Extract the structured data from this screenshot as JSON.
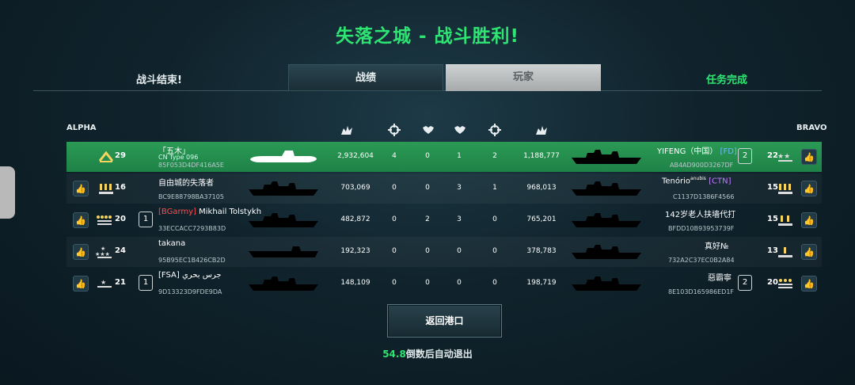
{
  "title": "失落之城 - 战斗胜利!",
  "header": {
    "battle_over": "战斗结束!",
    "tabs": [
      "战绩",
      "玩家"
    ],
    "mission_status": "任务完成"
  },
  "teams": {
    "left": "ALPHA",
    "right": "BRAVO"
  },
  "alpha": [
    {
      "level": "29",
      "name": "「五木」",
      "ship": "CN Type 096",
      "id": "85F053D4DF416A5E",
      "damage": "2,932,604",
      "kills": "4",
      "assists": "0",
      "highlight": true
    },
    {
      "level": "16",
      "name": "自由城的失落者",
      "ship": "",
      "id": "BC9E88798BA37105",
      "damage": "703,069",
      "kills": "0",
      "assists": "0"
    },
    {
      "level": "20",
      "clan": "[BGarmy]",
      "name": " Mikhail Tolstykh",
      "ship": "",
      "id": "33ECCACC7293B83D",
      "damage": "482,872",
      "kills": "0",
      "assists": "2",
      "squad": "1"
    },
    {
      "level": "24",
      "name": "takana",
      "ship": "",
      "id": "95B95EC1B426CB2D",
      "damage": "192,323",
      "kills": "0",
      "assists": "0"
    },
    {
      "level": "21",
      "name": "[FSA] جرس بحري",
      "ship": "",
      "id": "9D13323D9FDE9DA",
      "damage": "148,109",
      "kills": "0",
      "assists": "0",
      "squad": "1"
    }
  ],
  "bravo": [
    {
      "level": "22",
      "name": "YIFENG（中国）",
      "clan": "[FD]",
      "id": "AB4AD900D3267DF",
      "damage": "1,188,777",
      "kills": "2",
      "assists": "1",
      "squad": "2"
    },
    {
      "level": "15",
      "name": "Tenório",
      "sup": "anubis",
      "clan": "[CTN]",
      "id": "C1137D1386F4566",
      "damage": "968,013",
      "kills": "1",
      "assists": "3"
    },
    {
      "level": "15",
      "name": "142岁老人扶墙代打",
      "id": "BFDD10B93953739F",
      "damage": "765,201",
      "kills": "0",
      "assists": "3"
    },
    {
      "level": "13",
      "name": "真好№",
      "id": "732A2C37EC0B2A84",
      "damage": "378,783",
      "kills": "0",
      "assists": "0"
    },
    {
      "level": "20",
      "name": "惡霸寧",
      "id": "8E103D165986ED1F",
      "damage": "198,719",
      "kills": "0",
      "assists": "0",
      "squad": "2"
    }
  ],
  "footer": {
    "return_label": "返回港口",
    "countdown_value": "54.8",
    "countdown_text": "倒数后自动退出"
  },
  "colors": {
    "accent_green": "#2ee573",
    "clan_red": "#ff4d4d",
    "clan_blue": "#6fb6ff",
    "clan_purple": "#c07bff"
  }
}
